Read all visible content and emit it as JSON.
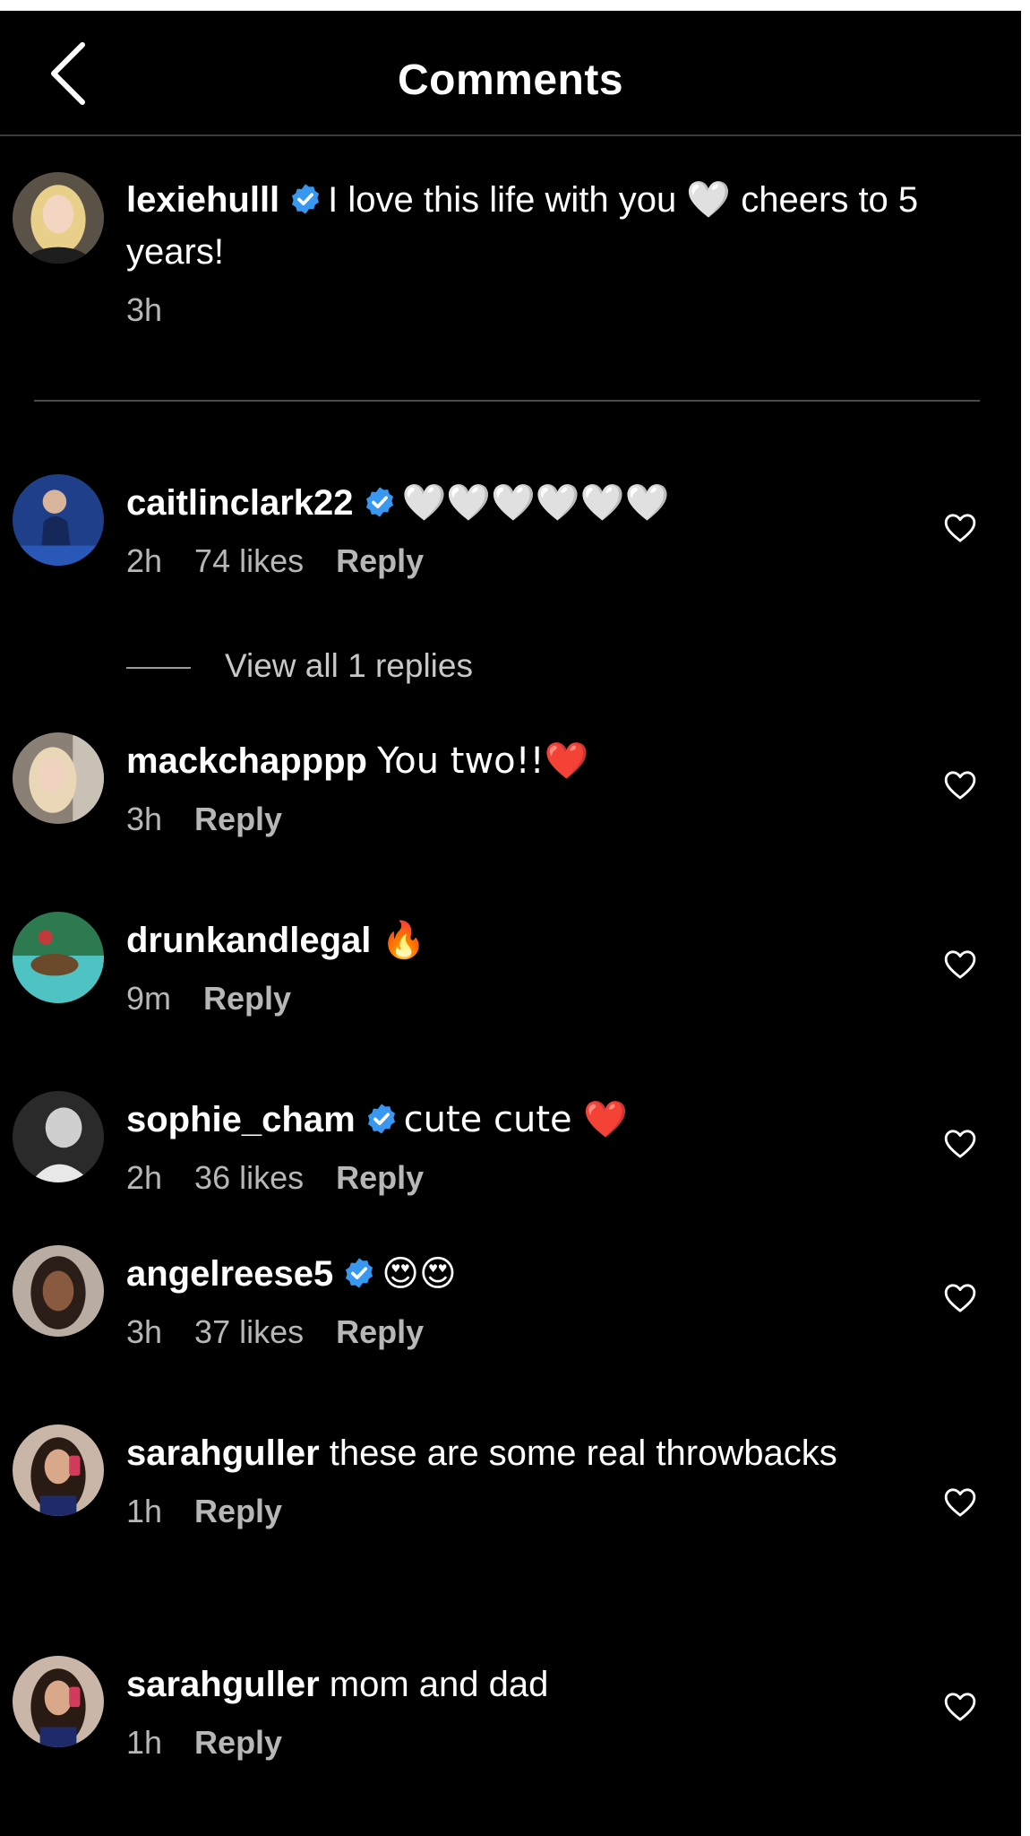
{
  "header": {
    "title": "Comments"
  },
  "caption": {
    "username": "lexiehulll",
    "verified": true,
    "text": "I love this life with you 🤍 cheers to 5 years!",
    "time": "3h"
  },
  "comments": [
    {
      "username": "caitlinclark22",
      "verified": true,
      "text": "🤍🤍🤍🤍🤍🤍",
      "time": "2h",
      "likes": "74 likes",
      "reply_label": "Reply"
    },
    {
      "username": "mackchapppp",
      "verified": false,
      "text": "You two!!❤️",
      "time": "3h",
      "reply_label": "Reply"
    },
    {
      "username": "drunkandlegal",
      "verified": false,
      "text": "🔥",
      "time": "9m",
      "reply_label": "Reply"
    },
    {
      "username": "sophie_cham",
      "verified": true,
      "text": "cute cute ❤️",
      "time": "2h",
      "likes": "36 likes",
      "reply_label": "Reply"
    },
    {
      "username": "angelreese5",
      "verified": true,
      "text": "😍😍",
      "time": "3h",
      "likes": "37 likes",
      "reply_label": "Reply"
    },
    {
      "username": "sarahguller",
      "verified": false,
      "text": "these are some real throwbacks",
      "time": "1h",
      "reply_label": "Reply"
    },
    {
      "username": "sarahguller",
      "verified": false,
      "text": "mom and dad",
      "time": "1h",
      "reply_label": "Reply"
    }
  ],
  "view_replies": "View all 1 replies",
  "icons": {
    "back": "chevron-left-icon",
    "verified": "verified-badge-icon",
    "like": "heart-outline-icon"
  },
  "colors": {
    "background": "#000000",
    "verified_blue": "#3897f0",
    "meta_gray": "#b7b7b7"
  }
}
